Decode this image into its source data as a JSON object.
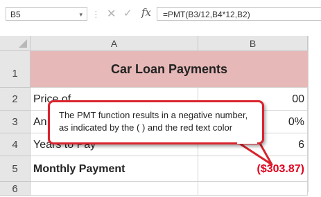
{
  "formula_bar": {
    "name_box": "B5",
    "formula": "=PMT(B3/12,B4*12,B2)",
    "fx_label": "fx",
    "cancel_glyph": "✕",
    "enter_glyph": "✓",
    "separator": "⋮",
    "dropdown_glyph": "▾"
  },
  "columns": [
    "A",
    "B"
  ],
  "rows": [
    {
      "num": "1"
    },
    {
      "num": "2",
      "a": "Price of",
      "b": "00"
    },
    {
      "num": "3",
      "a": "An",
      "b": "0%"
    },
    {
      "num": "4",
      "a": "Years to Pay",
      "b": "6"
    },
    {
      "num": "5",
      "a": "Monthly Payment",
      "b": "($303.87)"
    },
    {
      "num": "6"
    }
  ],
  "title": "Car Loan Payments",
  "callout": {
    "line1": "The PMT function results in a negative number,",
    "line2": "as indicated by the ( ) and the red text color"
  },
  "colors": {
    "title_fill": "#e6b8b7",
    "negative_text": "#e0001b",
    "callout_border": "#d9232d"
  }
}
